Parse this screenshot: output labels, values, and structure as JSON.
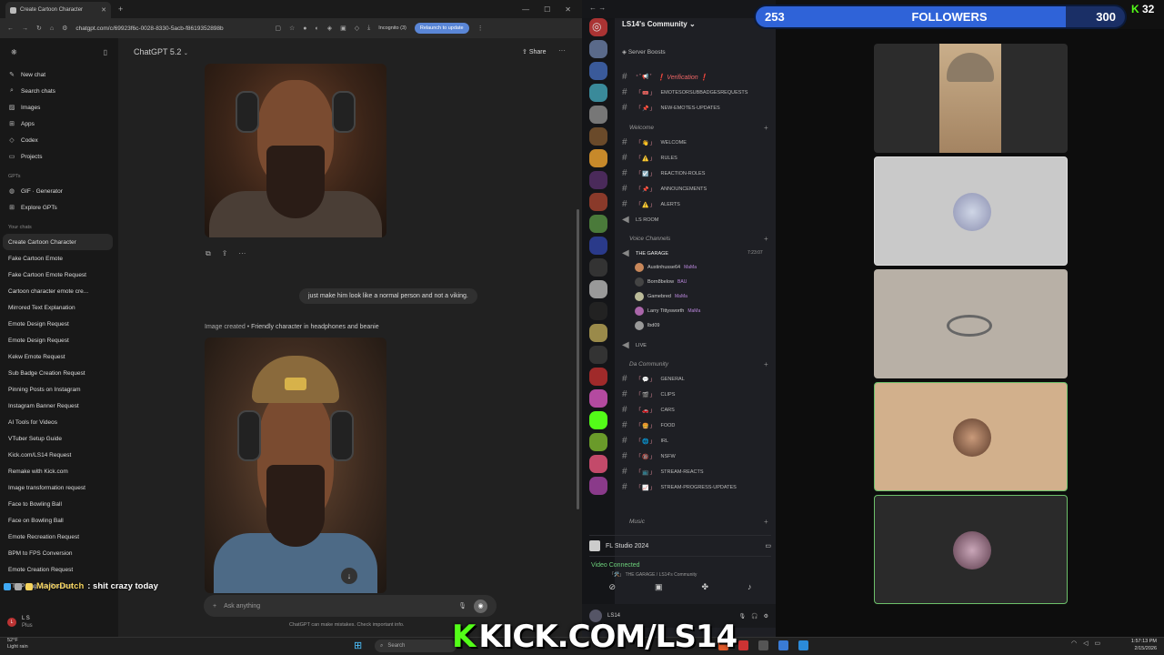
{
  "browser": {
    "tab_title": "Create Cartoon Character",
    "url": "chatgpt.com/c/69923f6c-0028-8330-5acb-f8619352898b",
    "incognito": "Incognito (3)",
    "relaunch": "Relaunch to update"
  },
  "chatgpt": {
    "model": "ChatGPT 5.2",
    "share": "Share",
    "nav": [
      {
        "icon": "pencil-icon",
        "label": "New chat"
      },
      {
        "icon": "search-icon",
        "label": "Search chats"
      },
      {
        "icon": "image-icon",
        "label": "Images"
      },
      {
        "icon": "apps-icon",
        "label": "Apps"
      },
      {
        "icon": "codex-icon",
        "label": "Codex"
      },
      {
        "icon": "folder-icon",
        "label": "Projects"
      }
    ],
    "gpts_header": "GPTs",
    "gpts": [
      {
        "icon": "gif-icon",
        "label": "GIF · Generator"
      },
      {
        "icon": "grid-icon",
        "label": "Explore GPTs"
      }
    ],
    "chats_header": "Your chats",
    "chats": [
      "Create Cartoon Character",
      "Fake Cartoon Emote",
      "Fake Cartoon Emote Request",
      "Cartoon character emote cre...",
      "Mirrored Text Explanation",
      "Emote Design Request",
      "Emote Design Request",
      "Kekw Emote Request",
      "Sub Badge Creation Request",
      "Pinning Posts on Instagram",
      "Instagram Banner Request",
      "AI Tools for Videos",
      "VTuber Setup Guide",
      "Kick.com/LS14 Request",
      "Remake with Kick.com",
      "Image transformation request",
      "Face to Bowling Ball",
      "Face on Bowling Ball",
      "Emote Recreation Request",
      "BPM to FPS Conversion",
      "Emote Creation Request",
      "TTS Paragraph Request"
    ],
    "user_name": "L S",
    "user_plan": "Plus",
    "user_message": "just make him look like a normal person and not a viking.",
    "image_caption_prefix": "Image created •",
    "image_caption": "Friendly character in headphones and beanie",
    "composer_placeholder": "Ask anything",
    "disclaimer": "ChatGPT can make mistakes. Check important info."
  },
  "stream_chat": {
    "user": "MajorDutch",
    "message": ": shit crazy today"
  },
  "discord": {
    "server": "LS14's Community",
    "server_boosts": "Server Boosts",
    "channels_top": [
      {
        "emoji": "⁺˚📢˚",
        "name": "❗ Verification ❗"
      },
      {
        "emoji": "「🎟️」",
        "name": "EMOTESORSUBBADGESREQUESTS"
      },
      {
        "emoji": "「📌」",
        "name": "NEW-EMOTES-UPDATES"
      }
    ],
    "cat_welcome": "Welcome",
    "channels_welcome": [
      {
        "emoji": "「👋」",
        "name": "WELCOME"
      },
      {
        "emoji": "「⚠️」",
        "name": "RULES"
      },
      {
        "emoji": "「☑️」",
        "name": "REACTION-ROLES"
      },
      {
        "emoji": "「📌」",
        "name": "ANNOUNCEMENTS"
      },
      {
        "emoji": "「⚠️」",
        "name": "ALERTS"
      }
    ],
    "ls_room": "LS ROOM",
    "cat_voice": "Voice Channels",
    "voice_channel": "THE GARAGE",
    "voice_time": "7:23:07",
    "voice_users": [
      {
        "name": "Austinhusse64",
        "tag": "MaMa"
      },
      {
        "name": "Born8below",
        "tag": "BAU"
      },
      {
        "name": "Gamebred",
        "tag": "MaMa"
      },
      {
        "name": "Larry Tittysworth",
        "tag": "MaMa"
      },
      {
        "name": "lbd09",
        "tag": ""
      }
    ],
    "live_channel": "LIVE",
    "cat_community": "Da Community",
    "channels_community": [
      {
        "emoji": "「💬」",
        "name": "GENERAL"
      },
      {
        "emoji": "「🎬」",
        "name": "CLIPS"
      },
      {
        "emoji": "「🚗」",
        "name": "CARS"
      },
      {
        "emoji": "「🍔」",
        "name": "FOOD"
      },
      {
        "emoji": "「🌐」",
        "name": "IRL"
      },
      {
        "emoji": "「🔞」",
        "name": "NSFW"
      },
      {
        "emoji": "「📺」",
        "name": "STREAM-REACTS"
      },
      {
        "emoji": "「📈」",
        "name": "STREAM-PROGRESS-UPDATES"
      }
    ],
    "cat_music": "Music",
    "activity": "FL Studio 2024",
    "voice_status": "Video Connected",
    "voice_sub": "「🛠️」 THE GARAGE / LS14's Community",
    "user": "LS14"
  },
  "overlay": {
    "followers_count": "253",
    "followers_label": "FOLLOWERS",
    "followers_goal": "300",
    "followers_progress": 0.84,
    "kick_count": "32",
    "kick_url": "KICK.COM/LS14"
  },
  "taskbar": {
    "temp": "52°F",
    "weather": "Light rain",
    "search": "Search",
    "time": "1:57:13 PM",
    "date": "2/15/2026"
  },
  "colors": {
    "kick_green": "#53fc18",
    "followers_bar": "#274fa8",
    "discord_bg": "#1e1f24"
  }
}
